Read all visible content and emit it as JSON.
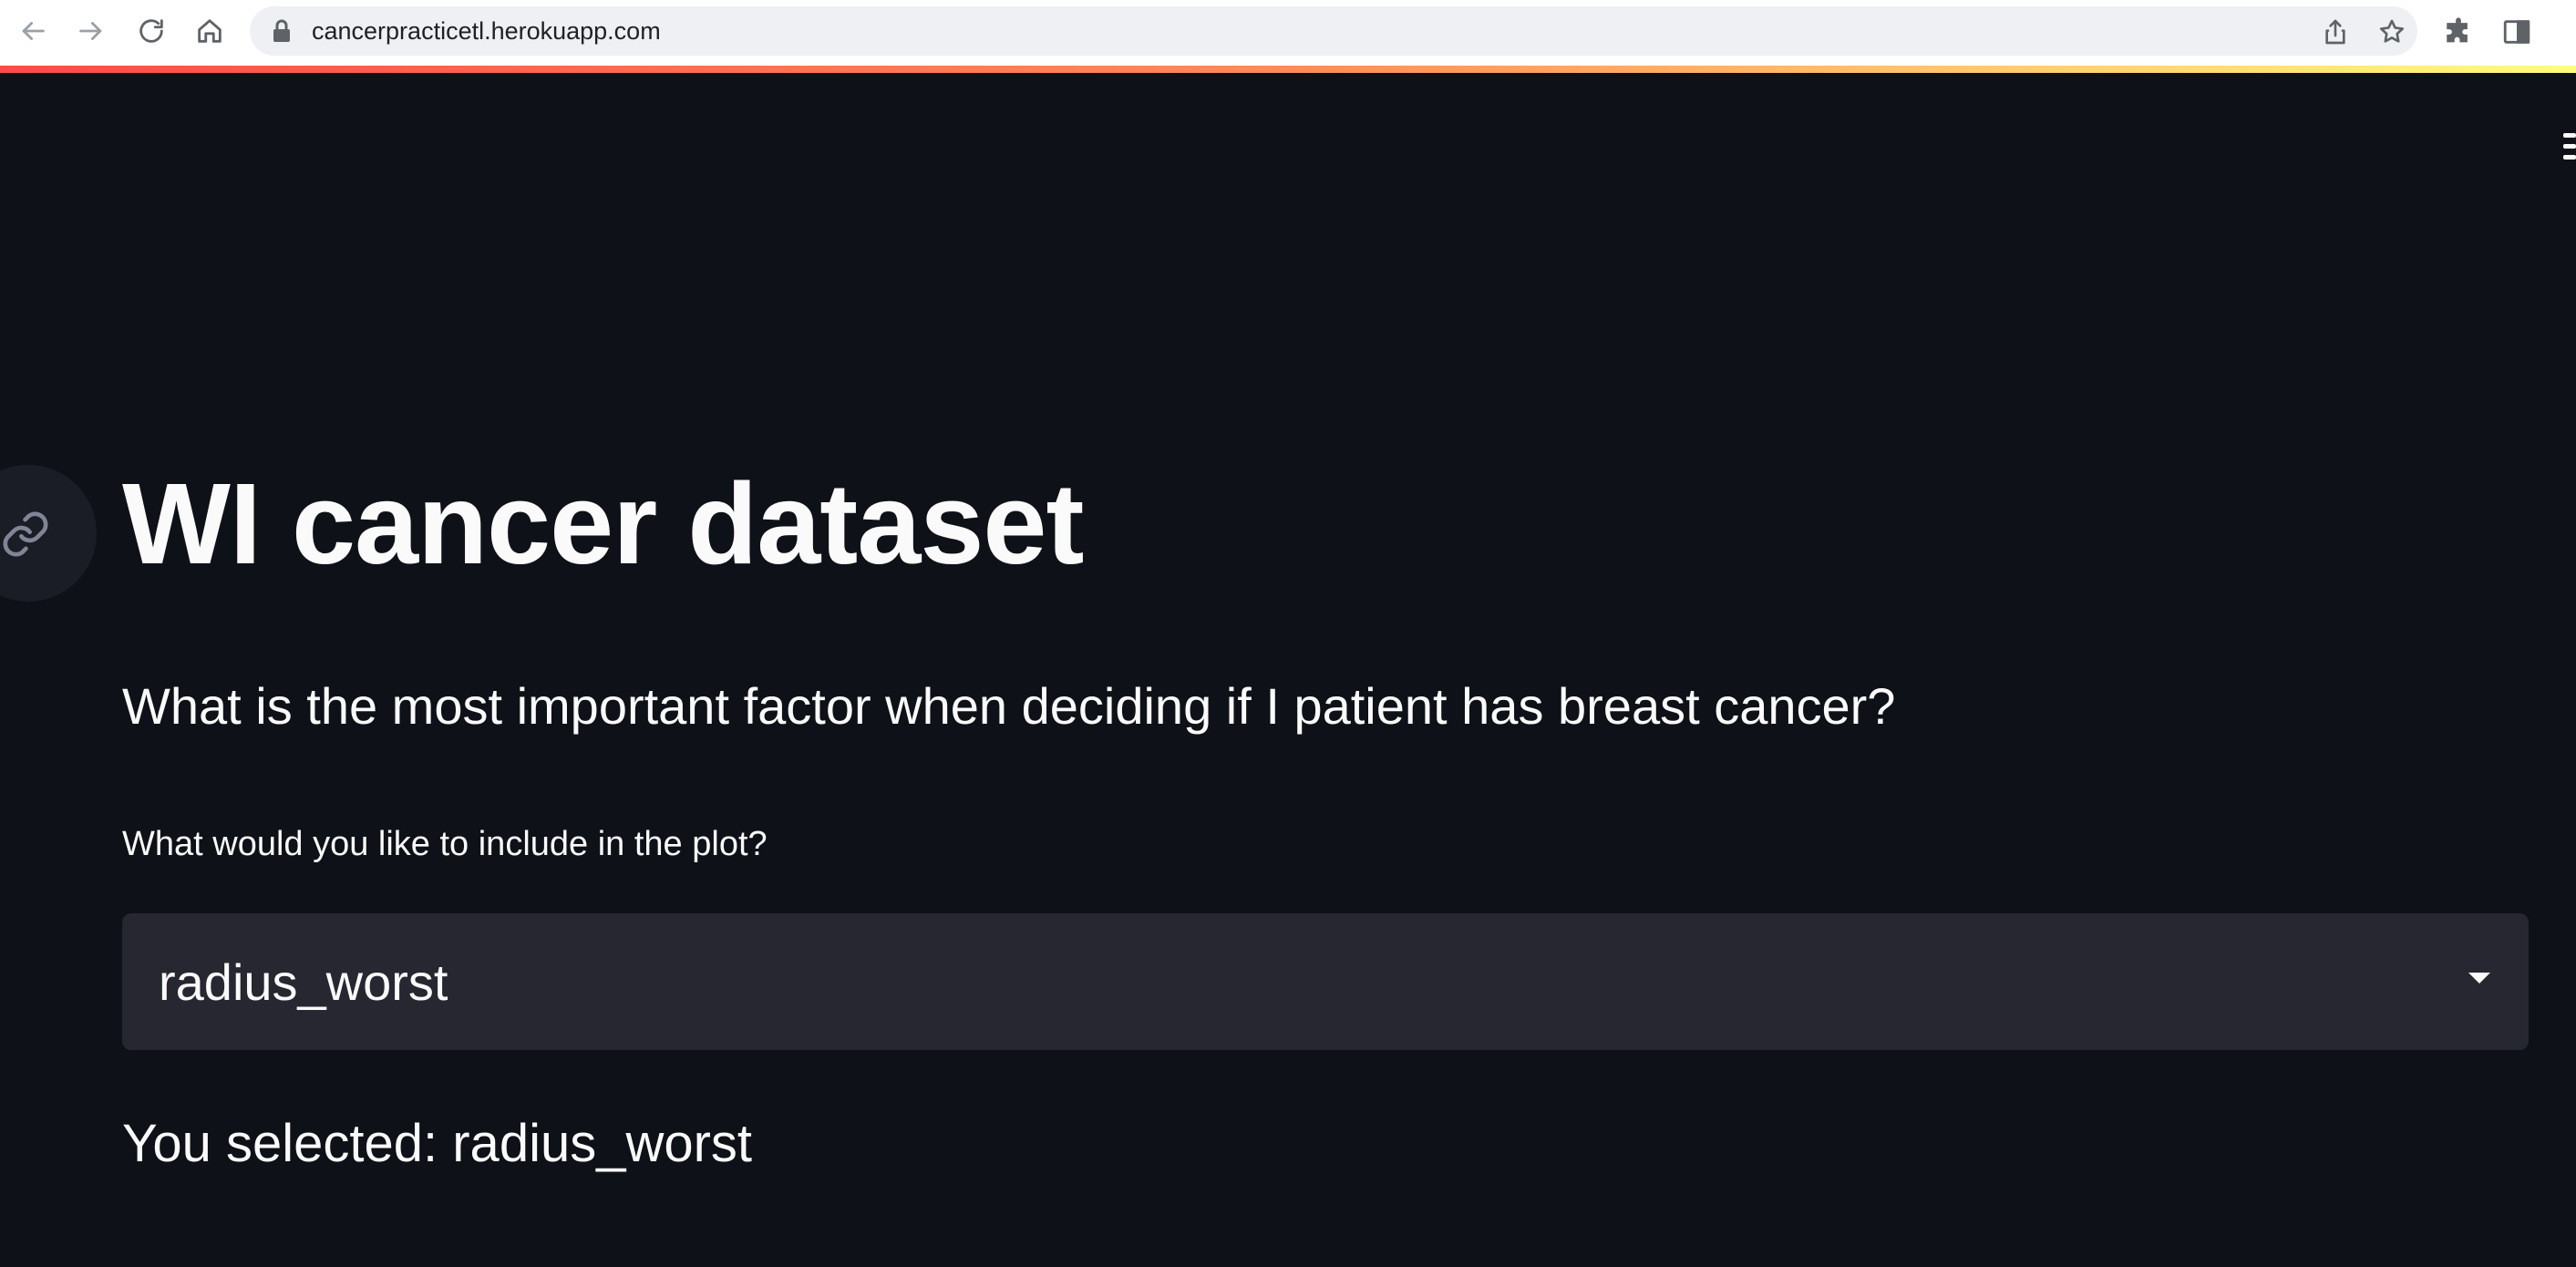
{
  "browser": {
    "url": "cancerpracticetl.herokuapp.com",
    "icons": [
      "back-arrow-icon",
      "forward-arrow-icon",
      "reload-icon",
      "home-icon",
      "lock-icon",
      "share-icon",
      "bookmark-star-icon",
      "extensions-puzzle-icon",
      "side-panel-icon"
    ]
  },
  "app": {
    "title": "WI cancer dataset",
    "subtitle": "What is the most important factor when deciding if I patient has breast cancer?",
    "select": {
      "label": "What would you like to include in the plot?",
      "value": "radius_worst"
    },
    "selected_text": "You selected: radius_worst"
  },
  "colors": {
    "background": "#0e1117",
    "select_background": "#262730",
    "text": "#fafafa",
    "accent_gradient": [
      "#ff4b4b",
      "#fffd80"
    ]
  }
}
